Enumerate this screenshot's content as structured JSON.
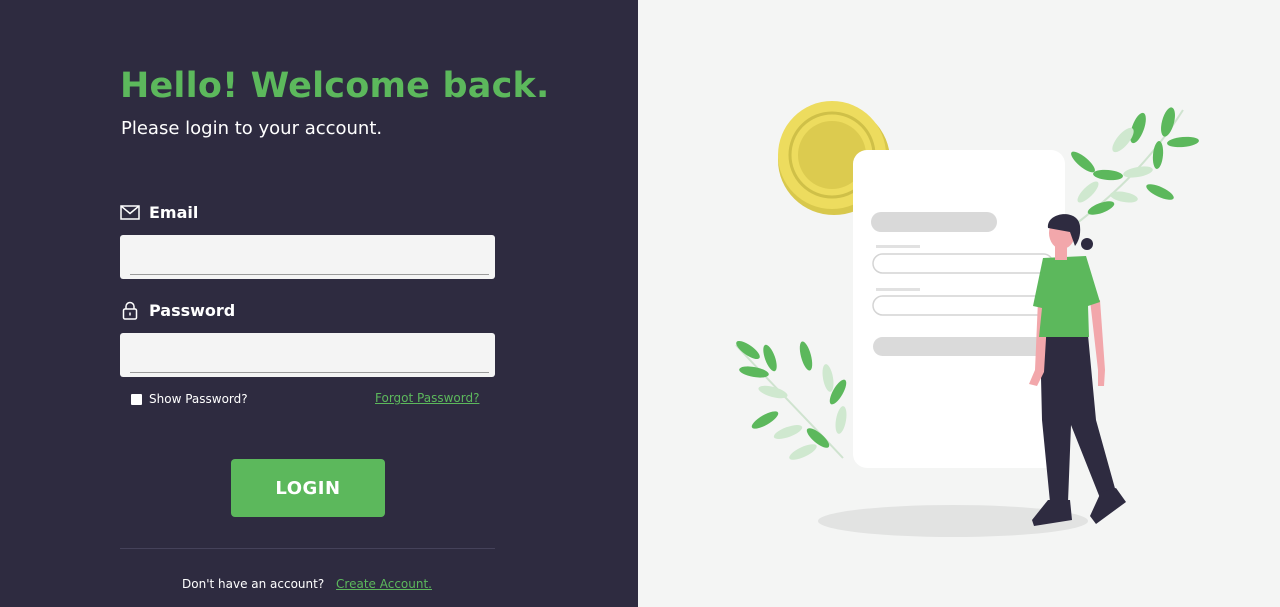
{
  "header": {
    "title": "Hello! Welcome back.",
    "subtitle": "Please login to your account."
  },
  "form": {
    "email": {
      "label": "Email",
      "icon": "envelope-icon",
      "value": "",
      "placeholder": ""
    },
    "password": {
      "label": "Password",
      "icon": "lock-icon",
      "value": "",
      "placeholder": ""
    },
    "show_password": {
      "label": "Show Password?",
      "checked": false
    },
    "forgot_password": "Forgot Password?",
    "login_button": "LOGIN"
  },
  "footer": {
    "prompt": "Don't have an account?",
    "create_account": "Create Account."
  },
  "colors": {
    "panel": "#2e2b40",
    "accent": "#5cb85c",
    "background": "#f4f5f4"
  }
}
